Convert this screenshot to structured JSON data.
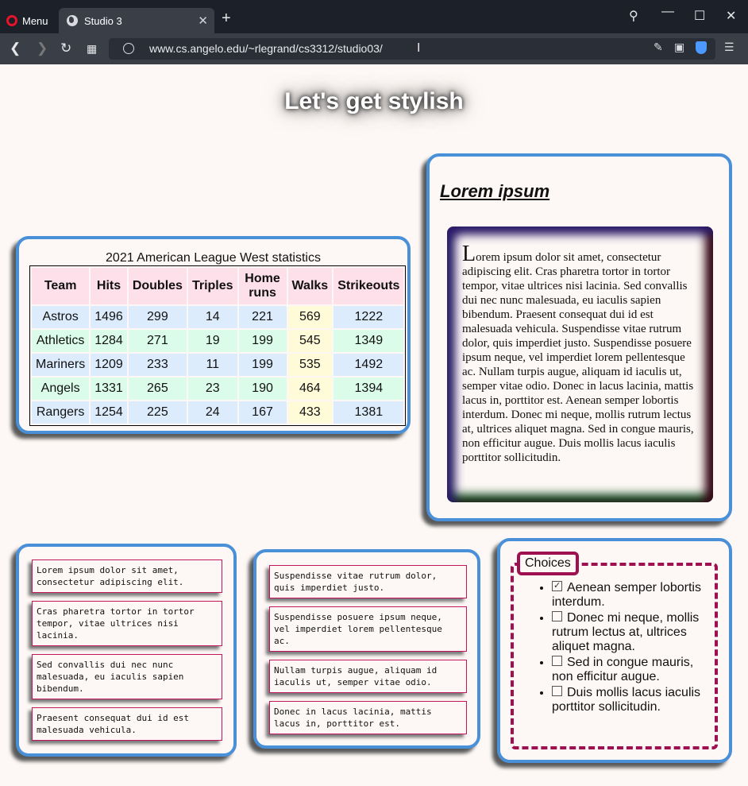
{
  "browser": {
    "menu_label": "Menu",
    "tab_title": "Studio 3",
    "tab_close": "✕",
    "new_tab": "+",
    "url": "www.cs.angelo.edu/~rlegrand/cs3312/studio03/",
    "colors": {
      "chrome_dark": "#1c2029",
      "chrome_toolbar": "#3a3e47",
      "opera_red": "#e5142a"
    }
  },
  "page": {
    "title": "Let's get stylish",
    "colors": {
      "background": "#fdf8f5",
      "card_border": "#4a90d9",
      "note_border": "#c2185b",
      "fieldset_border": "#9e1050"
    }
  },
  "stats_table": {
    "caption": "2021 American League West statistics",
    "headers": [
      "Team",
      "Hits",
      "Doubles",
      "Triples",
      "Home runs",
      "Walks",
      "Strikeouts"
    ],
    "rows": [
      [
        "Astros",
        "1496",
        "299",
        "14",
        "221",
        "569",
        "1222"
      ],
      [
        "Athletics",
        "1284",
        "271",
        "19",
        "199",
        "545",
        "1349"
      ],
      [
        "Mariners",
        "1209",
        "233",
        "11",
        "199",
        "535",
        "1492"
      ],
      [
        "Angels",
        "1331",
        "265",
        "23",
        "190",
        "464",
        "1394"
      ],
      [
        "Rangers",
        "1254",
        "225",
        "24",
        "167",
        "433",
        "1381"
      ]
    ]
  },
  "lorem": {
    "title": "Lorem ipsum",
    "dropcap": "L",
    "text": "orem ipsum dolor sit amet, consectetur adipiscing elit.  Cras pharetra tortor in tortor tempor, vitae ultrices nisi lacinia.  Sed convallis dui nec nunc malesuada, eu iaculis sapien bibendum.  Praesent consequat dui id est malesuada vehicula.  Suspendisse vitae rutrum dolor, quis imperdiet justo.  Suspendisse posuere ipsum neque, vel imperdiet lorem pellentesque ac.  Nullam turpis augue, aliquam id iaculis ut, semper vitae odio.  Donec in lacus lacinia, mattis lacus in, porttitor est.  Aenean semper lobortis interdum.  Donec mi neque, mollis rutrum lectus at, ultrices aliquet magna.  Sed in congue mauris, non efficitur augue.  Duis mollis lacus iaculis porttitor sollicitudin."
  },
  "notes_left": [
    "Lorem ipsum dolor sit amet, consectetur adipiscing elit.",
    "Cras pharetra tortor in tortor tempor, vitae ultrices nisi lacinia.",
    "Sed convallis dui nec nunc malesuada, eu iaculis sapien bibendum.",
    "Praesent consequat dui id est malesuada vehicula."
  ],
  "notes_mid": [
    "Suspendisse vitae rutrum dolor, quis imperdiet justo.",
    "Suspendisse posuere ipsum neque, vel imperdiet lorem pellentesque ac.",
    "Nullam turpis augue, aliquam id iaculis ut, semper vitae odio.",
    "Donec in lacus lacinia, mattis lacus in, porttitor est."
  ],
  "choices": {
    "legend": "Choices",
    "items": [
      {
        "label": "Aenean semper lobortis interdum.",
        "checked": true
      },
      {
        "label": "Donec mi neque, mollis rutrum lectus at, ultrices aliquet magna.",
        "checked": false
      },
      {
        "label": "Sed in congue mauris, non efficitur augue.",
        "checked": false
      },
      {
        "label": "Duis mollis lacus iaculis porttitor sollicitudin.",
        "checked": false
      }
    ]
  }
}
